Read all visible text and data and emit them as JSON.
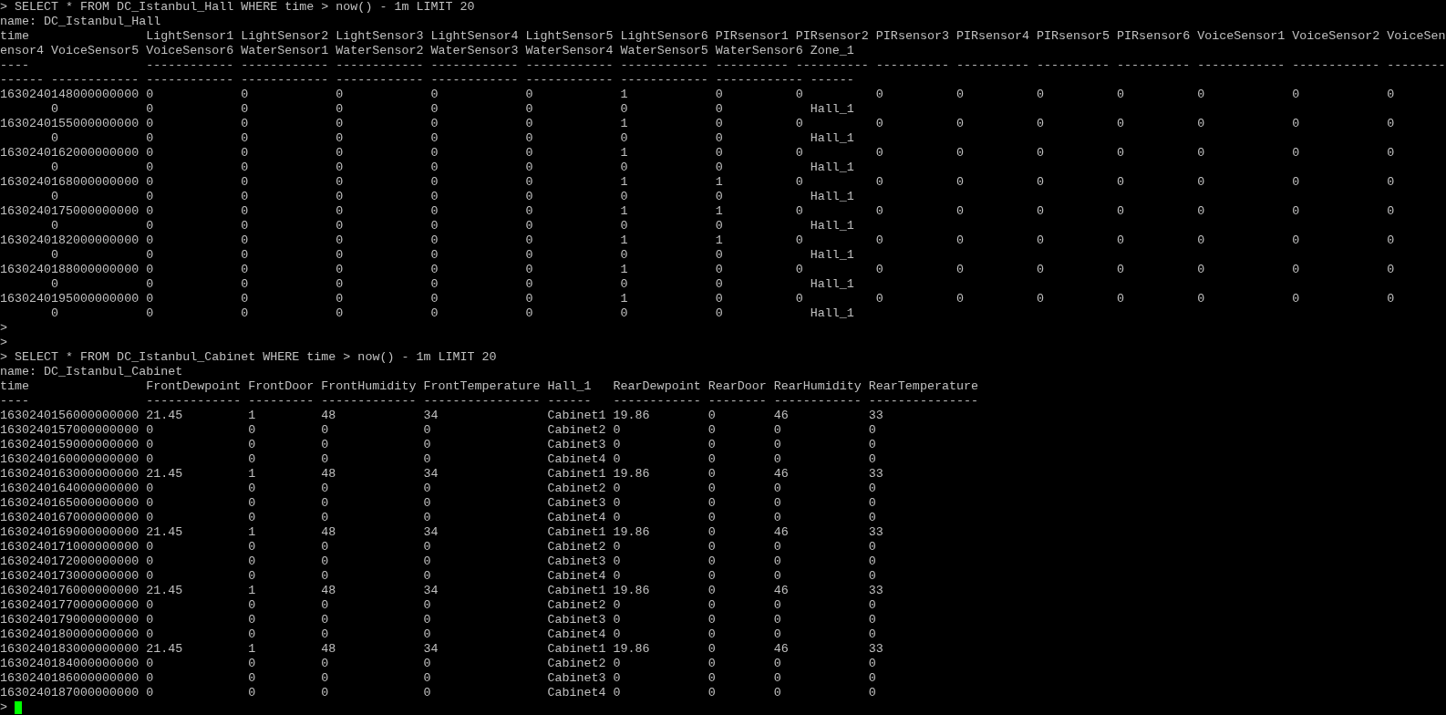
{
  "terminal": {
    "lines": [
      {
        "kind": "command",
        "cells": [
          "> SELECT * FROM DC_Istanbul_Hall WHERE time > now() - 1m LIMIT 20"
        ]
      },
      {
        "kind": "text",
        "cells": [
          "name: DC_Istanbul_Hall"
        ]
      },
      {
        "kind": "hall_head_a",
        "cells": [
          "time",
          "LightSensor1",
          "LightSensor2",
          "LightSensor3",
          "LightSensor4",
          "LightSensor5",
          "LightSensor6",
          "PIRsensor1",
          "PIRsensor2",
          "PIRsensor3",
          "PIRsensor4",
          "PIRsensor5",
          "PIRsensor6",
          "VoiceSensor1",
          "VoiceSensor2",
          "VoiceSen"
        ]
      },
      {
        "kind": "hall_head_b",
        "cells": [
          "ensor4",
          "VoiceSensor5",
          "VoiceSensor6",
          "WaterSensor1",
          "WaterSensor2",
          "WaterSensor3",
          "WaterSensor4",
          "WaterSensor5",
          "WaterSensor6",
          "Zone_1"
        ]
      },
      {
        "kind": "hall_rule_a",
        "cells": [
          "----",
          "------------",
          "------------",
          "------------",
          "------------",
          "------------",
          "------------",
          "----------",
          "----------",
          "----------",
          "----------",
          "----------",
          "----------",
          "------------",
          "------------",
          "--------"
        ]
      },
      {
        "kind": "hall_rule_b",
        "cells": [
          "------",
          "------------",
          "------------",
          "------------",
          "------------",
          "------------",
          "------------",
          "------------",
          "------------",
          "------"
        ]
      },
      {
        "kind": "hall_row_a",
        "cells": [
          "1630240148000000000",
          "0",
          "0",
          "0",
          "0",
          "0",
          "1",
          "0",
          "0",
          "0",
          "0",
          "0",
          "0",
          "0",
          "0",
          "0"
        ]
      },
      {
        "kind": "hall_row_b",
        "cells": [
          "0",
          "0",
          "0",
          "0",
          "0",
          "0",
          "0",
          "0",
          "Hall_1"
        ]
      },
      {
        "kind": "hall_row_a",
        "cells": [
          "1630240155000000000",
          "0",
          "0",
          "0",
          "0",
          "0",
          "1",
          "0",
          "0",
          "0",
          "0",
          "0",
          "0",
          "0",
          "0",
          "0"
        ]
      },
      {
        "kind": "hall_row_b",
        "cells": [
          "0",
          "0",
          "0",
          "0",
          "0",
          "0",
          "0",
          "0",
          "Hall_1"
        ]
      },
      {
        "kind": "hall_row_a",
        "cells": [
          "1630240162000000000",
          "0",
          "0",
          "0",
          "0",
          "0",
          "1",
          "0",
          "0",
          "0",
          "0",
          "0",
          "0",
          "0",
          "0",
          "0"
        ]
      },
      {
        "kind": "hall_row_b",
        "cells": [
          "0",
          "0",
          "0",
          "0",
          "0",
          "0",
          "0",
          "0",
          "Hall_1"
        ]
      },
      {
        "kind": "hall_row_a",
        "cells": [
          "1630240168000000000",
          "0",
          "0",
          "0",
          "0",
          "0",
          "1",
          "1",
          "0",
          "0",
          "0",
          "0",
          "0",
          "0",
          "0",
          "0"
        ]
      },
      {
        "kind": "hall_row_b",
        "cells": [
          "0",
          "0",
          "0",
          "0",
          "0",
          "0",
          "0",
          "0",
          "Hall_1"
        ]
      },
      {
        "kind": "hall_row_a",
        "cells": [
          "1630240175000000000",
          "0",
          "0",
          "0",
          "0",
          "0",
          "1",
          "1",
          "0",
          "0",
          "0",
          "0",
          "0",
          "0",
          "0",
          "0"
        ]
      },
      {
        "kind": "hall_row_b",
        "cells": [
          "0",
          "0",
          "0",
          "0",
          "0",
          "0",
          "0",
          "0",
          "Hall_1"
        ]
      },
      {
        "kind": "hall_row_a",
        "cells": [
          "1630240182000000000",
          "0",
          "0",
          "0",
          "0",
          "0",
          "1",
          "1",
          "0",
          "0",
          "0",
          "0",
          "0",
          "0",
          "0",
          "0"
        ]
      },
      {
        "kind": "hall_row_b",
        "cells": [
          "0",
          "0",
          "0",
          "0",
          "0",
          "0",
          "0",
          "0",
          "Hall_1"
        ]
      },
      {
        "kind": "hall_row_a",
        "cells": [
          "1630240188000000000",
          "0",
          "0",
          "0",
          "0",
          "0",
          "1",
          "0",
          "0",
          "0",
          "0",
          "0",
          "0",
          "0",
          "0",
          "0"
        ]
      },
      {
        "kind": "hall_row_b",
        "cells": [
          "0",
          "0",
          "0",
          "0",
          "0",
          "0",
          "0",
          "0",
          "Hall_1"
        ]
      },
      {
        "kind": "hall_row_a",
        "cells": [
          "1630240195000000000",
          "0",
          "0",
          "0",
          "0",
          "0",
          "1",
          "0",
          "0",
          "0",
          "0",
          "0",
          "0",
          "0",
          "0",
          "0"
        ]
      },
      {
        "kind": "hall_row_b",
        "cells": [
          "0",
          "0",
          "0",
          "0",
          "0",
          "0",
          "0",
          "0",
          "Hall_1"
        ]
      },
      {
        "kind": "command",
        "cells": [
          ">"
        ]
      },
      {
        "kind": "command",
        "cells": [
          ">"
        ]
      },
      {
        "kind": "command",
        "cells": [
          "> SELECT * FROM DC_Istanbul_Cabinet WHERE time > now() - 1m LIMIT 20"
        ]
      },
      {
        "kind": "text",
        "cells": [
          "name: DC_Istanbul_Cabinet"
        ]
      },
      {
        "kind": "cab_head",
        "cells": [
          "time",
          "FrontDewpoint",
          "FrontDoor",
          "FrontHumidity",
          "FrontTemperature",
          "Hall_1",
          "RearDewpoint",
          "RearDoor",
          "RearHumidity",
          "RearTemperature"
        ]
      },
      {
        "kind": "cab_rule",
        "cells": [
          "----",
          "-------------",
          "---------",
          "-------------",
          "----------------",
          "------",
          "------------",
          "--------",
          "------------",
          "---------------"
        ]
      },
      {
        "kind": "cab_row",
        "cells": [
          "1630240156000000000",
          "21.45",
          "1",
          "48",
          "34",
          "Cabinet1",
          "19.86",
          "0",
          "46",
          "33"
        ]
      },
      {
        "kind": "cab_row",
        "cells": [
          "1630240157000000000",
          "0",
          "0",
          "0",
          "0",
          "Cabinet2",
          "0",
          "0",
          "0",
          "0"
        ]
      },
      {
        "kind": "cab_row",
        "cells": [
          "1630240159000000000",
          "0",
          "0",
          "0",
          "0",
          "Cabinet3",
          "0",
          "0",
          "0",
          "0"
        ]
      },
      {
        "kind": "cab_row",
        "cells": [
          "1630240160000000000",
          "0",
          "0",
          "0",
          "0",
          "Cabinet4",
          "0",
          "0",
          "0",
          "0"
        ]
      },
      {
        "kind": "cab_row",
        "cells": [
          "1630240163000000000",
          "21.45",
          "1",
          "48",
          "34",
          "Cabinet1",
          "19.86",
          "0",
          "46",
          "33"
        ]
      },
      {
        "kind": "cab_row",
        "cells": [
          "1630240164000000000",
          "0",
          "0",
          "0",
          "0",
          "Cabinet2",
          "0",
          "0",
          "0",
          "0"
        ]
      },
      {
        "kind": "cab_row",
        "cells": [
          "1630240165000000000",
          "0",
          "0",
          "0",
          "0",
          "Cabinet3",
          "0",
          "0",
          "0",
          "0"
        ]
      },
      {
        "kind": "cab_row",
        "cells": [
          "1630240167000000000",
          "0",
          "0",
          "0",
          "0",
          "Cabinet4",
          "0",
          "0",
          "0",
          "0"
        ]
      },
      {
        "kind": "cab_row",
        "cells": [
          "1630240169000000000",
          "21.45",
          "1",
          "48",
          "34",
          "Cabinet1",
          "19.86",
          "0",
          "46",
          "33"
        ]
      },
      {
        "kind": "cab_row",
        "cells": [
          "1630240171000000000",
          "0",
          "0",
          "0",
          "0",
          "Cabinet2",
          "0",
          "0",
          "0",
          "0"
        ]
      },
      {
        "kind": "cab_row",
        "cells": [
          "1630240172000000000",
          "0",
          "0",
          "0",
          "0",
          "Cabinet3",
          "0",
          "0",
          "0",
          "0"
        ]
      },
      {
        "kind": "cab_row",
        "cells": [
          "1630240173000000000",
          "0",
          "0",
          "0",
          "0",
          "Cabinet4",
          "0",
          "0",
          "0",
          "0"
        ]
      },
      {
        "kind": "cab_row",
        "cells": [
          "1630240176000000000",
          "21.45",
          "1",
          "48",
          "34",
          "Cabinet1",
          "19.86",
          "0",
          "46",
          "33"
        ]
      },
      {
        "kind": "cab_row",
        "cells": [
          "1630240177000000000",
          "0",
          "0",
          "0",
          "0",
          "Cabinet2",
          "0",
          "0",
          "0",
          "0"
        ]
      },
      {
        "kind": "cab_row",
        "cells": [
          "1630240179000000000",
          "0",
          "0",
          "0",
          "0",
          "Cabinet3",
          "0",
          "0",
          "0",
          "0"
        ]
      },
      {
        "kind": "cab_row",
        "cells": [
          "1630240180000000000",
          "0",
          "0",
          "0",
          "0",
          "Cabinet4",
          "0",
          "0",
          "0",
          "0"
        ]
      },
      {
        "kind": "cab_row",
        "cells": [
          "1630240183000000000",
          "21.45",
          "1",
          "48",
          "34",
          "Cabinet1",
          "19.86",
          "0",
          "46",
          "33"
        ]
      },
      {
        "kind": "cab_row",
        "cells": [
          "1630240184000000000",
          "0",
          "0",
          "0",
          "0",
          "Cabinet2",
          "0",
          "0",
          "0",
          "0"
        ]
      },
      {
        "kind": "cab_row",
        "cells": [
          "1630240186000000000",
          "0",
          "0",
          "0",
          "0",
          "Cabinet3",
          "0",
          "0",
          "0",
          "0"
        ]
      },
      {
        "kind": "cab_row",
        "cells": [
          "1630240187000000000",
          "0",
          "0",
          "0",
          "0",
          "Cabinet4",
          "0",
          "0",
          "0",
          "0"
        ]
      },
      {
        "kind": "prompt",
        "cells": [
          ">"
        ]
      }
    ]
  }
}
